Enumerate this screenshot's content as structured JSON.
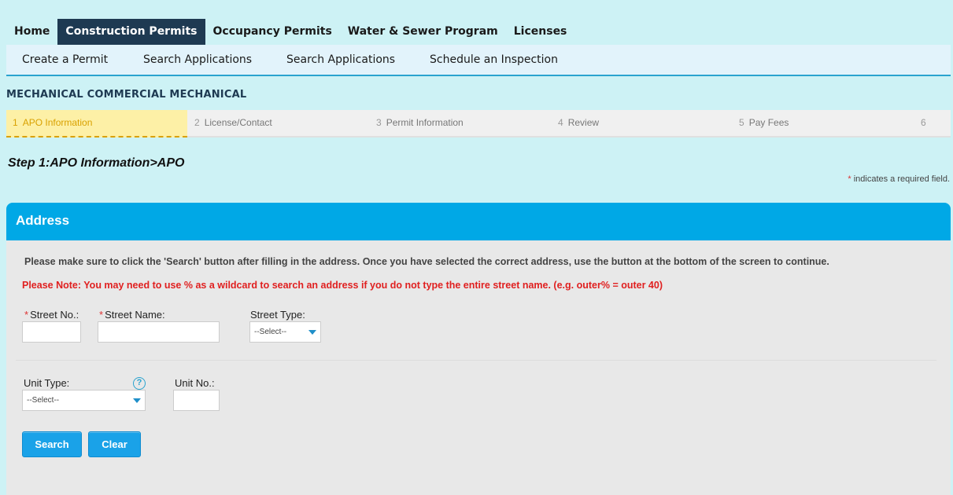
{
  "topnav": {
    "tabs": [
      {
        "label": "Home",
        "active": false
      },
      {
        "label": "Construction Permits",
        "active": true
      },
      {
        "label": "Occupancy Permits",
        "active": false
      },
      {
        "label": "Water & Sewer Program",
        "active": false
      },
      {
        "label": "Licenses",
        "active": false
      }
    ]
  },
  "subnav": {
    "items": [
      "Create a Permit",
      "Search Applications",
      "Search Applications",
      "Schedule an Inspection"
    ]
  },
  "record_title": "MECHANICAL COMMERCIAL MECHANICAL",
  "steps": [
    {
      "num": "1",
      "label": "APO Information",
      "active": true
    },
    {
      "num": "2",
      "label": "License/Contact",
      "active": false
    },
    {
      "num": "3",
      "label": "Permit Information",
      "active": false
    },
    {
      "num": "4",
      "label": "Review",
      "active": false
    },
    {
      "num": "5",
      "label": "Pay Fees",
      "active": false
    },
    {
      "num": "6",
      "label": "",
      "active": false
    }
  ],
  "step_heading": "Step 1:APO Information>APO",
  "required_note": {
    "star": "*",
    "text": "indicates a required field."
  },
  "section": {
    "title": "Address",
    "instructions": "Please make sure to click the 'Search' button after filling in the address. Once you have selected the correct address, use the button at the bottom of the screen to continue.",
    "note": "Please Note: You may need to use % as a wildcard to search an address if you do not type the entire street name. (e.g. outer% = outer 40)"
  },
  "form": {
    "street_no": {
      "label": "Street No.:",
      "required": "*",
      "value": ""
    },
    "street_name": {
      "label": "Street Name:",
      "required": "*",
      "value": ""
    },
    "street_type": {
      "label": "Street Type:",
      "selected": "--Select--"
    },
    "unit_type": {
      "label": "Unit Type:",
      "selected": "--Select--"
    },
    "unit_no": {
      "label": "Unit No.:",
      "value": ""
    },
    "help_glyph": "?"
  },
  "buttons": {
    "search": "Search",
    "clear": "Clear"
  },
  "colors": {
    "accent": "#00a8e6",
    "nav_active": "#1e3a52",
    "required": "#d33333",
    "note": "#e02020",
    "step_active": "#fdf0a6"
  }
}
